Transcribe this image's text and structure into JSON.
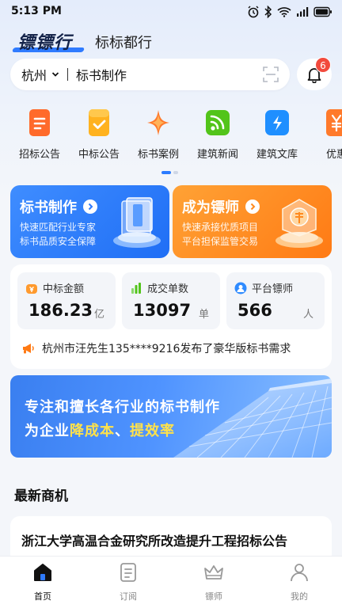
{
  "status_bar": {
    "time": "5:13 PM",
    "battery": "100"
  },
  "header": {
    "logo_text": "镖镖行",
    "brand_name": "标标都行"
  },
  "search": {
    "city": "杭州",
    "query": "标书制作"
  },
  "notifications": {
    "badge_count": "6"
  },
  "categories": [
    {
      "label": "招标公告",
      "icon": "document-icon",
      "color": "#ff6a2b"
    },
    {
      "label": "中标公告",
      "icon": "check-document-icon",
      "color": "#ffb21f"
    },
    {
      "label": "标书案例",
      "icon": "sparkle-icon",
      "color": "#ff7a2b"
    },
    {
      "label": "建筑新闻",
      "icon": "rss-icon",
      "color": "#52c41a"
    },
    {
      "label": "建筑文库",
      "icon": "lightning-book-icon",
      "color": "#1f8fff"
    },
    {
      "label": "优惠",
      "icon": "yuan-icon",
      "color": "#ff7a2b"
    }
  ],
  "promos": [
    {
      "title": "标书制作",
      "line1": "快速匹配行业专家",
      "line2": "标书品质安全保障",
      "color": "#2f7bff"
    },
    {
      "title": "成为镖师",
      "line1": "快速承接优质项目",
      "line2": "平台担保监管交易",
      "color": "#ff8a1e"
    }
  ],
  "stats": [
    {
      "label": "中标金额",
      "value": "186.23",
      "unit": "亿",
      "icon": "money-bag-icon",
      "color": "#ff9a2e"
    },
    {
      "label": "成交单数",
      "value": "13097",
      "unit": "单",
      "icon": "bar-chart-icon",
      "color": "#52c41a"
    },
    {
      "label": "平台镖师",
      "value": "566",
      "unit": "人",
      "icon": "user-icon",
      "color": "#2f8bff"
    }
  ],
  "notice": {
    "text": "杭州市汪先生135****9216发布了豪华版标书需求"
  },
  "banner": {
    "line1": "专注和擅长各行业的标书制作",
    "line2_prefix": "为企业",
    "line2_hl1": "降成本",
    "line2_mid": "、",
    "line2_hl2": "提效率"
  },
  "section": {
    "title": "最新商机"
  },
  "opportunity": {
    "title": "浙江大学高温合金研究所改造提升工程招标公告"
  },
  "tabs": [
    {
      "label": "首页",
      "icon": "home-icon",
      "active": true
    },
    {
      "label": "订阅",
      "icon": "subscribe-icon",
      "active": false
    },
    {
      "label": "镖师",
      "icon": "crown-icon",
      "active": false
    },
    {
      "label": "我的",
      "icon": "profile-icon",
      "active": false
    }
  ]
}
